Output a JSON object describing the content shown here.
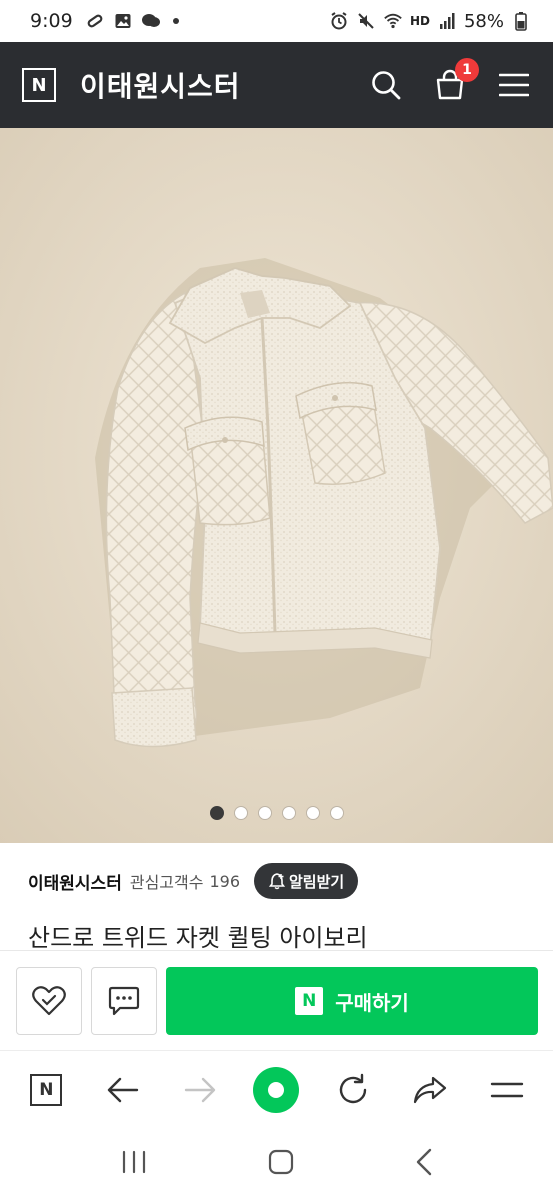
{
  "status_bar": {
    "time": "9:09",
    "battery": "58%",
    "network_label": "HD"
  },
  "header": {
    "logo_letter": "N",
    "store_title": "이태원시스터",
    "cart_count": "1"
  },
  "gallery": {
    "image_alt": "ivory quilted tweed jacket photo",
    "total_images": 6,
    "active_index": 0
  },
  "store": {
    "name": "이태원시스터",
    "follow_label": "관심고객수",
    "follow_count": "196",
    "alarm_label": "알림받기"
  },
  "product": {
    "title": "산드로 트위드 자켓 퀼팅 아이보리"
  },
  "purchase": {
    "buy_logo": "N",
    "buy_label": "구매하기"
  },
  "toolbar": {
    "logo_letter": "N"
  },
  "colors": {
    "header_bg": "#2b2d31",
    "brand_green": "#03c75a",
    "badge_red": "#ef3a3a"
  }
}
